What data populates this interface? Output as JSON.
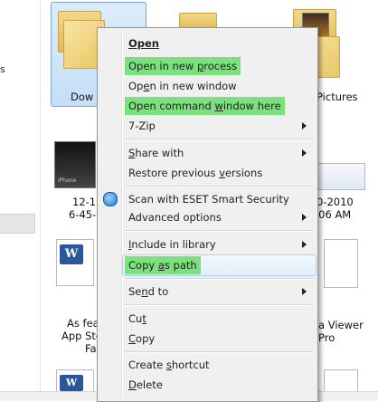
{
  "left_nav": {
    "label_s": "s"
  },
  "folders": [
    {
      "label": "Dow"
    },
    {
      "label": ""
    },
    {
      "label": "Pictures"
    }
  ],
  "files_row2": [
    {
      "line1": "12-1",
      "line2": "6-45-"
    },
    {
      "line1": "0-2010",
      "line2": "-06 AM"
    }
  ],
  "files_row3": [
    {
      "line1": "As fea",
      "line2": "App Sto",
      "line3": "Fa"
    },
    {
      "line1": "a Viewer",
      "line2": "Pro"
    }
  ],
  "thumb_text": {
    "iphone": "iPhone"
  },
  "context_menu": {
    "items": [
      {
        "id": "open",
        "label": "Open",
        "pre": "",
        "u": "",
        "post": "",
        "bold": true
      },
      {
        "id": "open-new-process",
        "pre": "Open in new ",
        "u": "p",
        "post": "rocess",
        "highlight": true
      },
      {
        "id": "open-new-window",
        "pre": "Op",
        "u": "e",
        "post": "n in new window"
      },
      {
        "id": "open-cmd",
        "pre": "Open command ",
        "u": "w",
        "post": "indow here",
        "highlight": true
      },
      {
        "id": "7zip",
        "label": "7-Zip",
        "submenu": true
      },
      {
        "id": "share-with",
        "pre": "",
        "u": "S",
        "post": "hare with",
        "submenu": true
      },
      {
        "id": "restore",
        "pre": "Restore previous ",
        "u": "v",
        "post": "ersions"
      },
      {
        "id": "eset",
        "label": "Scan with ESET Smart Security"
      },
      {
        "id": "advanced",
        "label": "Advanced options",
        "submenu": true
      },
      {
        "id": "include-library",
        "pre": "",
        "u": "I",
        "post": "nclude in library",
        "submenu": true
      },
      {
        "id": "copy-as-path",
        "pre": "Copy ",
        "u": "a",
        "post": "s path",
        "highlight": true
      },
      {
        "id": "send-to",
        "pre": "Se",
        "u": "n",
        "post": "d to",
        "submenu": true
      },
      {
        "id": "cut",
        "pre": "Cu",
        "u": "t",
        "post": ""
      },
      {
        "id": "copy",
        "pre": "",
        "u": "C",
        "post": "opy"
      },
      {
        "id": "create-shortcut",
        "pre": "Create ",
        "u": "s",
        "post": "hortcut"
      },
      {
        "id": "delete",
        "pre": "",
        "u": "D",
        "post": "elete"
      }
    ]
  },
  "colors": {
    "highlight": "#7be07d",
    "menu_bg": "#f0f0f0",
    "selection": "#c5dff7"
  },
  "icons": [
    "folder-icon",
    "eset-shield-icon",
    "word-document-icon",
    "submenu-arrow-icon"
  ]
}
